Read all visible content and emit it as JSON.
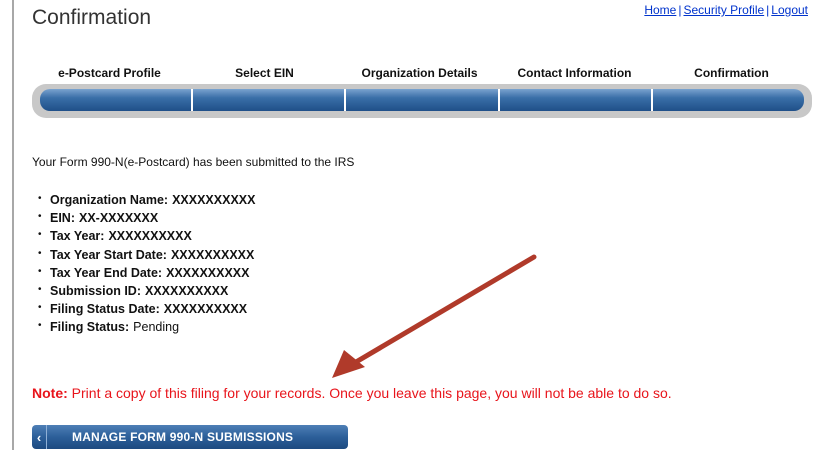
{
  "page": {
    "title": "Confirmation"
  },
  "top_links": {
    "home": "Home",
    "security_profile": "Security Profile",
    "logout": "Logout",
    "separator": "|"
  },
  "steps": [
    {
      "label": "e-Postcard Profile"
    },
    {
      "label": "Select EIN"
    },
    {
      "label": "Organization Details"
    },
    {
      "label": "Contact Information"
    },
    {
      "label": "Confirmation"
    }
  ],
  "main": {
    "submitted_message": "Your Form 990-N(e-Postcard) has been submitted to the IRS",
    "details": [
      {
        "label": "Organization Name:",
        "value": "XXXXXXXXXX"
      },
      {
        "label": "EIN:",
        "value": "XX-XXXXXXX"
      },
      {
        "label": "Tax Year:",
        "value": "XXXXXXXXXX"
      },
      {
        "label": "Tax Year Start Date:",
        "value": "XXXXXXXXXX"
      },
      {
        "label": "Tax Year End Date:",
        "value": "XXXXXXXXXX"
      },
      {
        "label": "Submission ID:",
        "value": "XXXXXXXXXX"
      },
      {
        "label": "Filing Status Date:",
        "value": "XXXXXXXXXX"
      },
      {
        "label": "Filing Status:",
        "value": "Pending"
      }
    ],
    "note_label": "Note:",
    "note_text": " Print a copy of this filing for your records. Once you leave this page, you will not be able to do so."
  },
  "actions": {
    "manage_button_label": "MANAGE FORM 990-N SUBMISSIONS",
    "back_chevron_icon": "chevron-left-icon"
  },
  "annotation": {
    "arrow_color": "#b03a2a"
  },
  "colors": {
    "note_red": "#e8141b",
    "link_blue": "#0033cc",
    "progress_blue": "#2c5f99"
  }
}
